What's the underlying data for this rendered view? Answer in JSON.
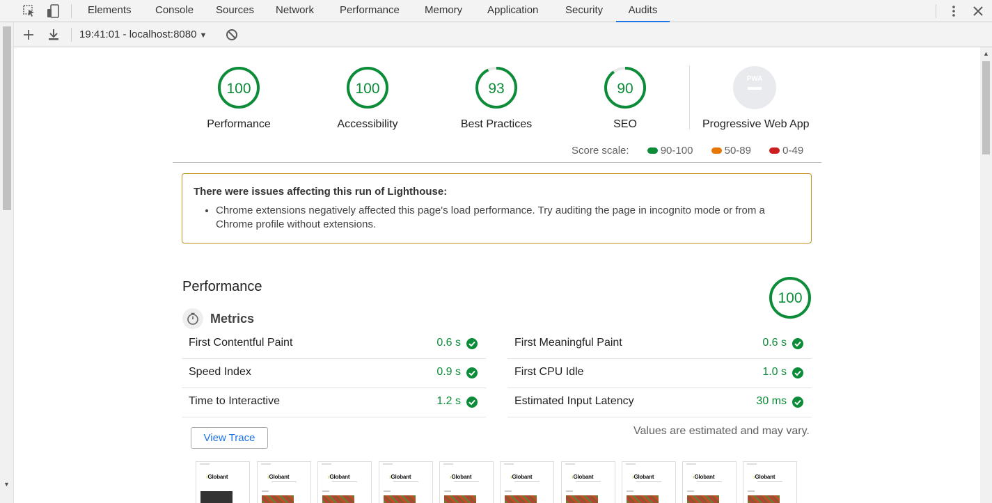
{
  "devtools": {
    "tabs": [
      {
        "label": "Elements"
      },
      {
        "label": "Console"
      },
      {
        "label": "Sources"
      },
      {
        "label": "Network"
      },
      {
        "label": "Performance"
      },
      {
        "label": "Memory"
      },
      {
        "label": "Application"
      },
      {
        "label": "Security"
      },
      {
        "label": "Audits"
      }
    ],
    "active_tab": "Audits"
  },
  "toolbar": {
    "report": "19:41:01 - localhost:8080"
  },
  "scores": [
    {
      "label": "Performance",
      "score": "100",
      "value": 100
    },
    {
      "label": "Accessibility",
      "score": "100",
      "value": 100
    },
    {
      "label": "Best Practices",
      "score": "93",
      "value": 93
    },
    {
      "label": "SEO",
      "score": "90",
      "value": 90
    }
  ],
  "pwa": {
    "label": "Progressive Web App",
    "badge": "PWA"
  },
  "score_scale": {
    "label": "Score scale:",
    "ranges": [
      {
        "label": "90-100",
        "color": "#0c8c39"
      },
      {
        "label": "50-89",
        "color": "#e67700"
      },
      {
        "label": "0-49",
        "color": "#cc1f1f"
      }
    ]
  },
  "warning": {
    "title": "There were issues affecting this run of Lighthouse:",
    "items": [
      "Chrome extensions negatively affected this page's load performance. Try auditing the page in incognito mode or from a Chrome profile without extensions."
    ]
  },
  "performance": {
    "title": "Performance",
    "score": "100",
    "metrics_title": "Metrics",
    "metrics": [
      {
        "name": "First Contentful Paint",
        "value": "0.6 s"
      },
      {
        "name": "First Meaningful Paint",
        "value": "0.6 s"
      },
      {
        "name": "Speed Index",
        "value": "0.9 s"
      },
      {
        "name": "First CPU Idle",
        "value": "1.0 s"
      },
      {
        "name": "Time to Interactive",
        "value": "1.2 s"
      },
      {
        "name": "Estimated Input Latency",
        "value": "30 ms"
      }
    ],
    "view_trace": "View Trace",
    "note": "Values are estimated and may vary.",
    "filmstrip_logo": "Globant"
  },
  "colors": {
    "pass": "#0c8c39",
    "accent": "#1a73e8",
    "warning_border": "#c3911f"
  }
}
